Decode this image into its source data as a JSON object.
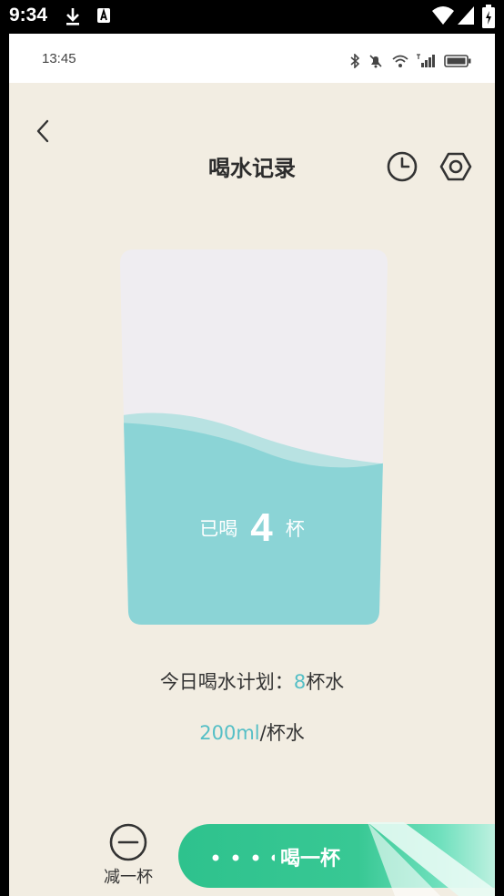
{
  "system_bar": {
    "time": "9:34"
  },
  "app_status": {
    "time": "13:45"
  },
  "header": {
    "title": "喝水记录"
  },
  "cup": {
    "prefix": "已喝",
    "count": "4",
    "suffix": "杯",
    "fill_fraction": 0.53
  },
  "plan": {
    "label": "今日喝水计划：",
    "target": "8",
    "unit": "杯水"
  },
  "per_cup": {
    "amount": "200ml",
    "unit": "/杯水"
  },
  "actions": {
    "minus_label": "减一杯",
    "drink_label": "喝一杯"
  },
  "colors": {
    "background": "#f2ede2",
    "water": "#8bd4d6",
    "accent": "#55bfc6",
    "button": "#2ec28d"
  },
  "icons": [
    "download-icon",
    "text-a-icon",
    "wifi-icon",
    "signal-icon",
    "battery-icon",
    "bluetooth-icon",
    "mute-icon",
    "back-arrow-icon",
    "clock-icon",
    "settings-icon",
    "minus-circle-icon"
  ]
}
